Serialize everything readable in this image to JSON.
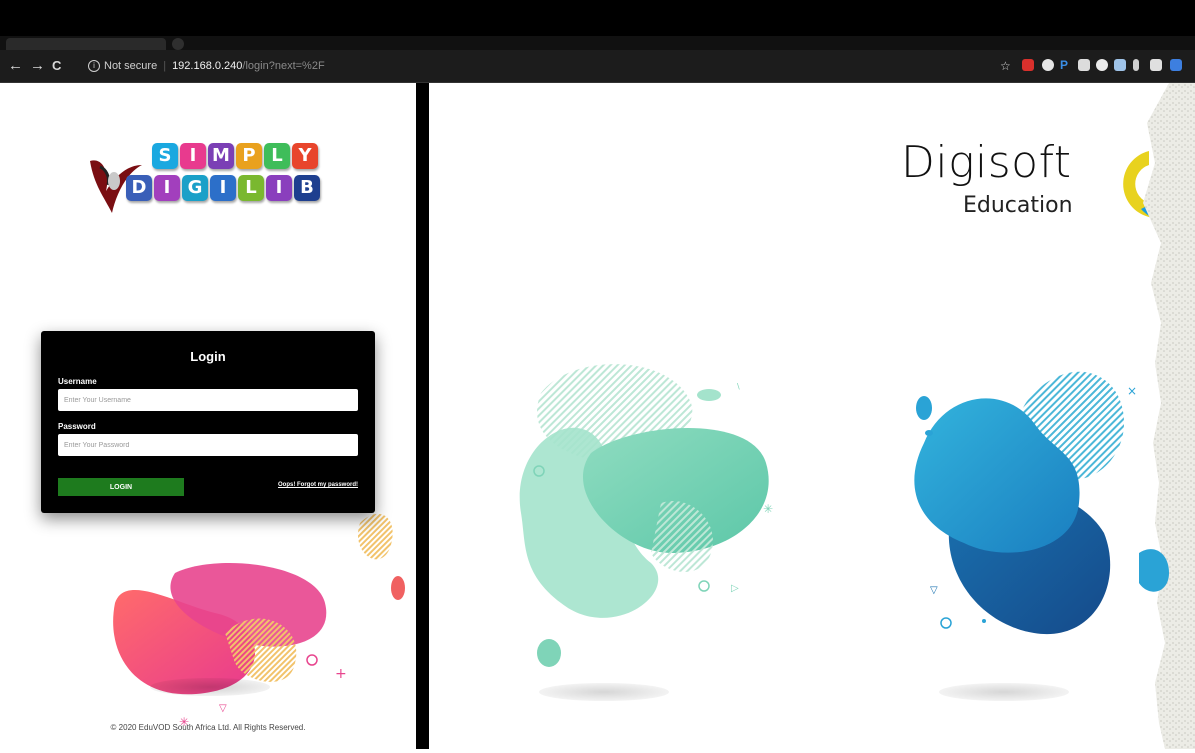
{
  "browser": {
    "not_secure_label": "Not secure",
    "url_host": "192.168.0.240",
    "url_path": "/login?next=%2F",
    "nav": {
      "back": "←",
      "forward": "→",
      "reload": "C"
    },
    "star_icon": "☆"
  },
  "logo": {
    "top_letters": [
      "S",
      "I",
      "M",
      "P",
      "L",
      "Y"
    ],
    "bottom_letters": [
      "D",
      "I",
      "G",
      "I",
      "L",
      "I",
      "B"
    ],
    "top_colors": [
      "#1aa8e0",
      "#e83a8e",
      "#7b3fb5",
      "#e9a11e",
      "#3fbd5a",
      "#e8452c"
    ],
    "bottom_colors": [
      "#3a5fb8",
      "#a23fbd",
      "#1aa0c8",
      "#2c6fc9",
      "#7ab82f",
      "#8a3fbd",
      "#1e3f8f"
    ]
  },
  "login": {
    "title": "Login",
    "username_label": "Username",
    "username_placeholder": "Enter Your Username",
    "username_value": "",
    "password_label": "Password",
    "password_placeholder": "Enter Your Password",
    "password_value": "",
    "login_button": "LOGIN",
    "forgot_link": "Oops! Forgot my password!"
  },
  "footer": {
    "copyright": "© 2020 EduVOD South Africa Ltd. All Rights Reserved."
  },
  "brand": {
    "name": "Digisoft",
    "sub": "Education"
  },
  "colors": {
    "button_green": "#1e7b1e",
    "mint": "#6ecfb0",
    "teal_blue": "#1a8fbf"
  }
}
